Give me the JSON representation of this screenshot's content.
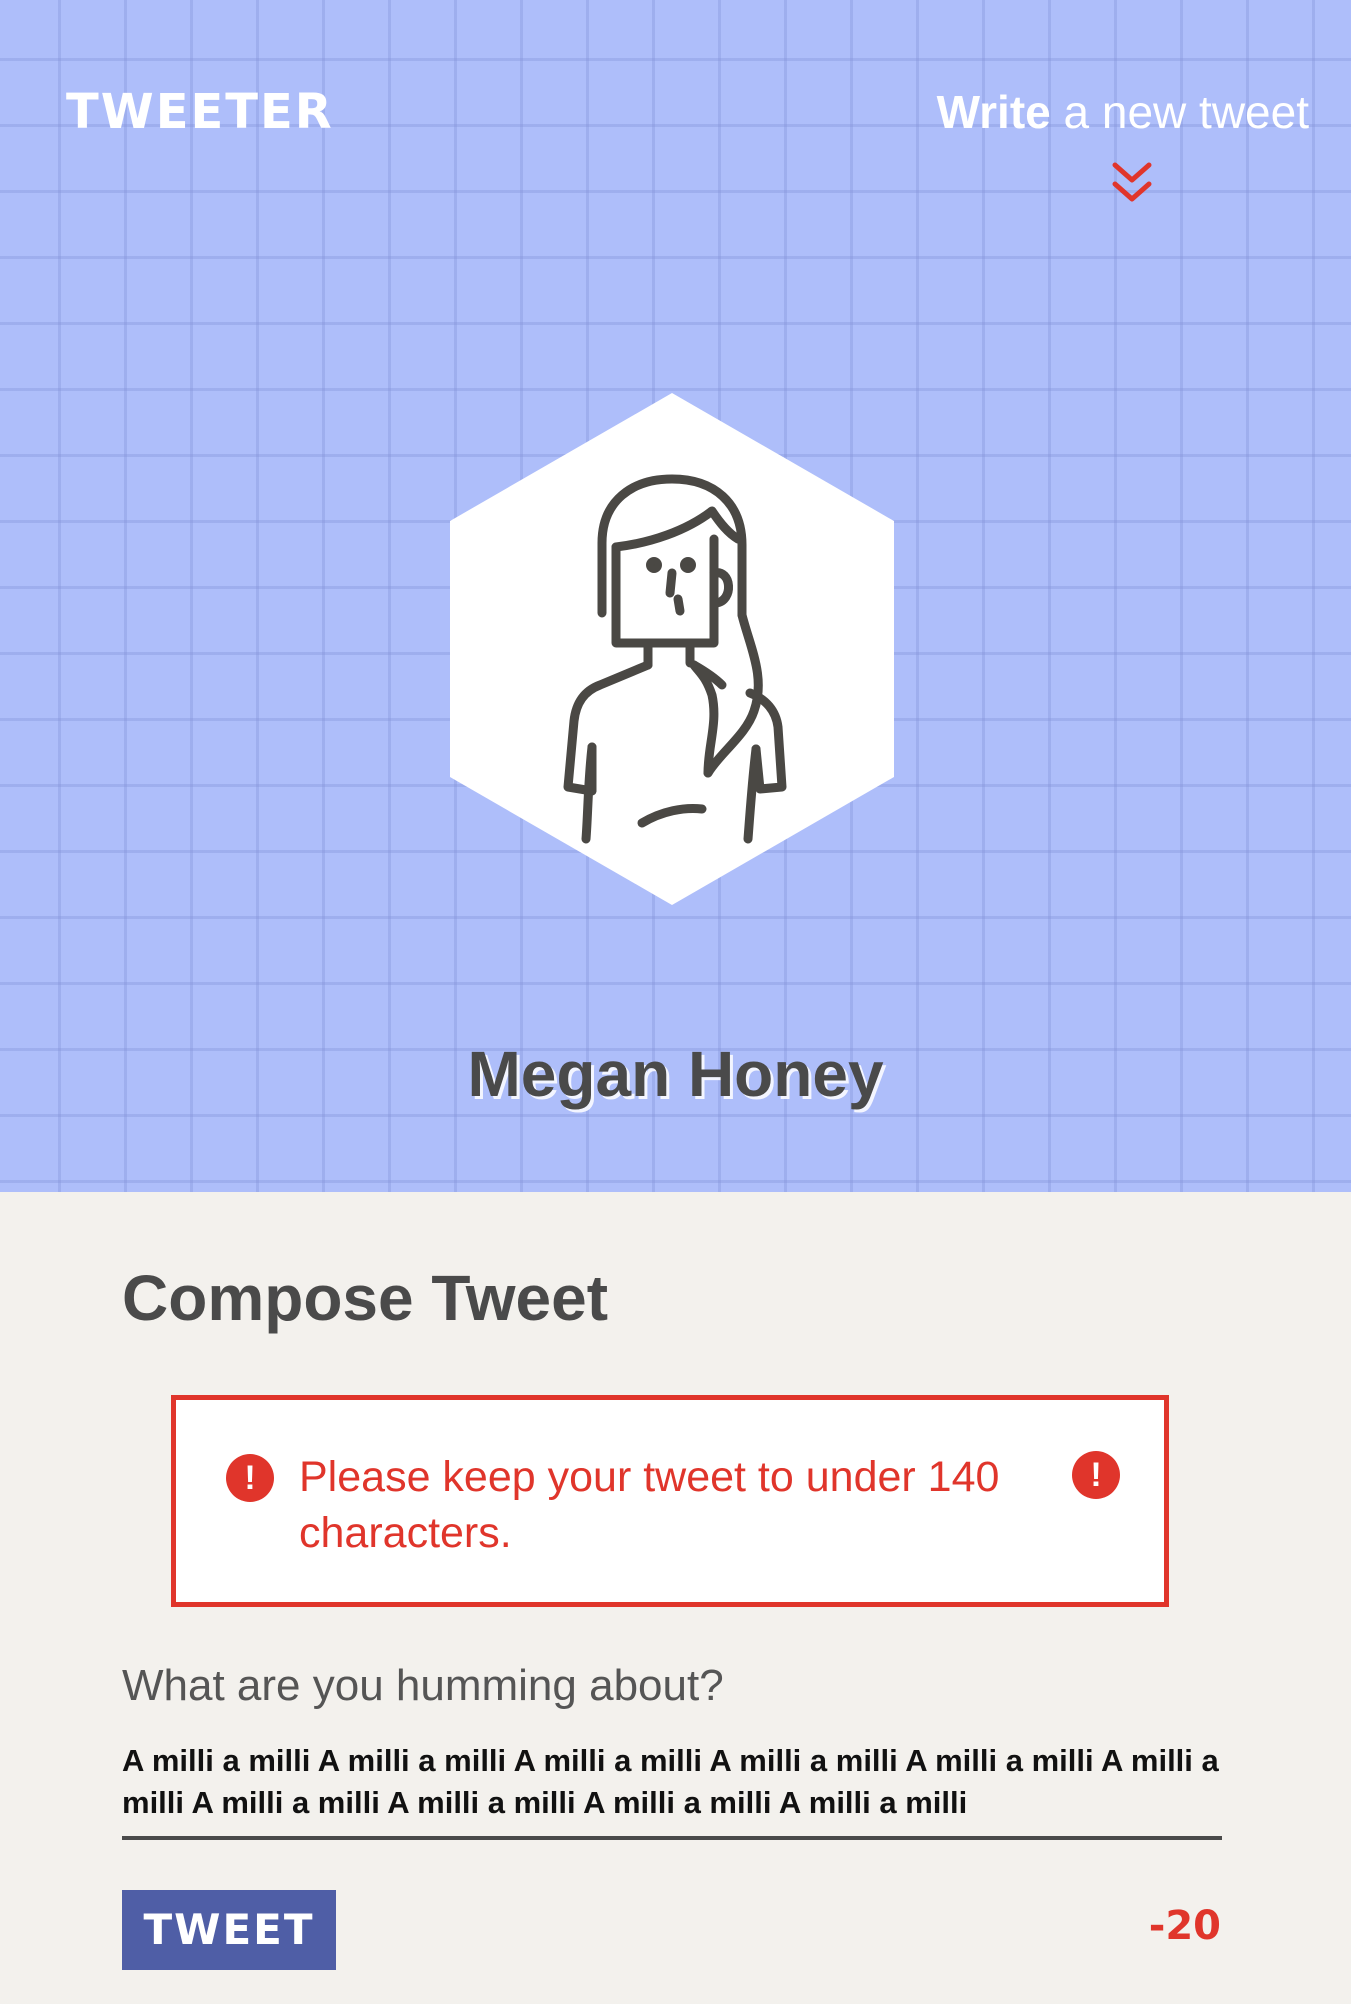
{
  "header": {
    "logo": "TWEETER",
    "write_link": {
      "strong": "Write",
      "rest": " a new tweet"
    },
    "chevron_icon": "double-chevron-down-icon",
    "avatar_icon": "woman-avatar-icon",
    "profile_name": "Megan Honey"
  },
  "compose": {
    "title": "Compose Tweet",
    "error": {
      "message": "Please keep your tweet to under 140 characters.",
      "icon": "exclamation-icon",
      "icon_glyph": "!"
    },
    "prompt_label": "What are you humming about?",
    "tweet_text": "A milli a milli A milli a milli A milli a milli A milli a milli A milli a milli A milli a milli A milli a milli A milli a milli A milli a milli A milli a milli",
    "tweet_button_label": "TWEET",
    "char_counter": "-20"
  },
  "colors": {
    "header_background": "#aebefa",
    "accent_red": "#e0352b",
    "button_blue": "#4f5ea6",
    "text_dark": "#4a4a4a",
    "page_background": "#f3f1ed"
  }
}
